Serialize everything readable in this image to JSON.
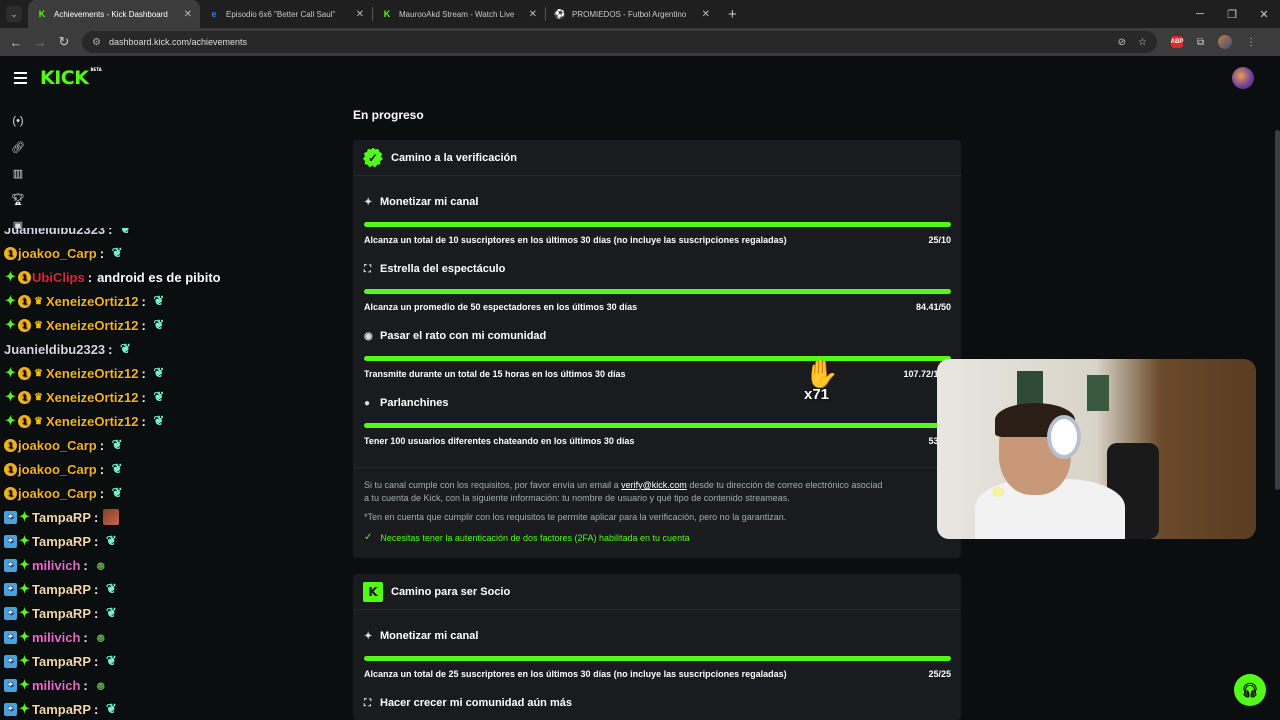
{
  "browser": {
    "tabs": [
      {
        "title": "Achievements - Kick Dashboard",
        "active": true,
        "favicon": "K",
        "color": "#53fc18"
      },
      {
        "title": "Episodio 6x6 \"Better Call Saul\"",
        "active": false,
        "favicon": "e",
        "color": "#2f7bd9"
      },
      {
        "title": "MaurooAkd Stream - Watch Live",
        "active": false,
        "favicon": "K",
        "color": "#53fc18"
      },
      {
        "title": "PROMIEDOS - Futbol Argentino",
        "active": false,
        "favicon": "⚽",
        "color": "#3fbf3f"
      }
    ],
    "url": "dashboard.kick.com/achievements"
  },
  "header": {
    "logo": "KICK",
    "logo_sup": "BETA"
  },
  "main": {
    "section_title": "En progreso",
    "card1": {
      "title": "Camino a la verificación",
      "goals": [
        {
          "name": "Monetizar mi canal",
          "desc": "Alcanza un total de 10 suscriptores en los últimos 30 días (no incluye las suscripciones regaladas)",
          "value": "25/10",
          "progress": 1.0
        },
        {
          "name": "Estrella del espectáculo",
          "desc": "Alcanza un promedio de 50 espectadores en los últimos 30 días",
          "value": "84.41/50",
          "progress": 1.0
        },
        {
          "name": "Pasar el rato con mi comunidad",
          "desc": "Transmite durante un total de 15 horas en los últimos 30 días",
          "value": "107.72/15.0",
          "progress": 1.0
        },
        {
          "name": "Parlanchines",
          "desc": "Tener 100 usuarios diferentes chateando en los últimos 30 días",
          "value": "538/1",
          "progress": 1.0
        }
      ],
      "note_pre": "Si tu canal cumple con los requisitos, por favor envía un email a",
      "note_email": "verify@kick.com",
      "note_post": "desde tu dirección de correo electrónico asociad",
      "note_line2": "a tu cuenta de Kick, con la siguiente información: tu nombre de usuario y qué tipo de contenido streameas.",
      "disclaimer": "*Ten en cuenta que cumplir con los requisitos te permite aplicar para la verificación, pero no la garantizan.",
      "requirement": "Necesitas tener la autenticación de dos factores (2FA) habilitada en tu cuenta"
    },
    "card2": {
      "title": "Camino para ser Socio",
      "goals": [
        {
          "name": "Monetizar mi canal",
          "desc": "Alcanza un total de 25 suscriptores en los últimos 30 días (no incluye las suscripciones regaladas)",
          "value": "25/25",
          "progress": 1.0
        },
        {
          "name": "Hacer crecer mi comunidad aún más"
        }
      ]
    }
  },
  "chat": [
    {
      "user": "Juanieldibu2323",
      "color": "#d6d6e8",
      "badges": [],
      "emote": "mint"
    },
    {
      "user": "joakoo_Carp",
      "color": "#f3b51b",
      "badges": [
        "gold"
      ],
      "emote": "mint"
    },
    {
      "user": "UbiClips",
      "color": "#e0243c",
      "badges": [
        "green",
        "gold"
      ],
      "text": "android es de pibito"
    },
    {
      "user": "XeneizeOrtiz12",
      "color": "#f3b51b",
      "badges": [
        "green",
        "gold",
        "crown"
      ],
      "emote": "mint"
    },
    {
      "user": "XeneizeOrtiz12",
      "color": "#f3b51b",
      "badges": [
        "green",
        "gold",
        "crown"
      ],
      "emote": "mint"
    },
    {
      "user": "Juanieldibu2323",
      "color": "#d6d6e8",
      "badges": [],
      "emote": "mint"
    },
    {
      "user": "XeneizeOrtiz12",
      "color": "#f3b51b",
      "badges": [
        "green",
        "gold",
        "crown"
      ],
      "emote": "mint"
    },
    {
      "user": "XeneizeOrtiz12",
      "color": "#f3b51b",
      "badges": [
        "green",
        "gold",
        "crown"
      ],
      "emote": "mint"
    },
    {
      "user": "XeneizeOrtiz12",
      "color": "#f3b51b",
      "badges": [
        "green",
        "gold",
        "crown"
      ],
      "emote": "mint"
    },
    {
      "user": "joakoo_Carp",
      "color": "#f3b51b",
      "badges": [
        "gold"
      ],
      "emote": "mint"
    },
    {
      "user": "joakoo_Carp",
      "color": "#f3b51b",
      "badges": [
        "gold"
      ],
      "emote": "mint"
    },
    {
      "user": "joakoo_Carp",
      "color": "#f3b51b",
      "badges": [
        "gold"
      ],
      "emote": "mint"
    },
    {
      "user": "TampaRP",
      "color": "#f3d8a8",
      "badges": [
        "blue",
        "green"
      ],
      "emote": "img"
    },
    {
      "user": "TampaRP",
      "color": "#f3d8a8",
      "badges": [
        "blue",
        "green"
      ],
      "emote": "mint"
    },
    {
      "user": "milivich",
      "color": "#e86ad3",
      "badges": [
        "blue",
        "green"
      ],
      "emote": "pepe"
    },
    {
      "user": "TampaRP",
      "color": "#f3d8a8",
      "badges": [
        "blue",
        "green"
      ],
      "emote": "mint"
    },
    {
      "user": "TampaRP",
      "color": "#f3d8a8",
      "badges": [
        "blue",
        "green"
      ],
      "emote": "mint"
    },
    {
      "user": "milivich",
      "color": "#e86ad3",
      "badges": [
        "blue",
        "green"
      ],
      "emote": "pepe"
    },
    {
      "user": "TampaRP",
      "color": "#f3d8a8",
      "badges": [
        "blue",
        "green"
      ],
      "emote": "mint"
    },
    {
      "user": "milivich",
      "color": "#e86ad3",
      "badges": [
        "blue",
        "green"
      ],
      "emote": "pepe"
    },
    {
      "user": "TampaRP",
      "color": "#f3d8a8",
      "badges": [
        "blue",
        "green"
      ],
      "emote": "mint"
    }
  ],
  "overlay": {
    "emote_count": "x71"
  },
  "colors": {
    "accent": "#53fc18",
    "card": "#191b1f",
    "bg": "#0b0e0f"
  }
}
